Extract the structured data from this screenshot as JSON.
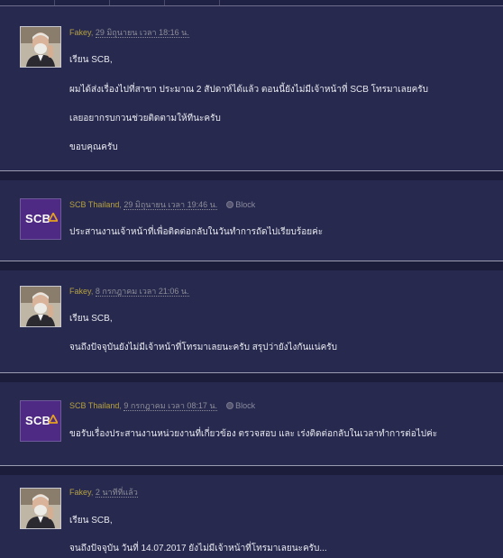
{
  "comments": [
    {
      "author": "Fakey",
      "time": "29 มิถุนายน เวลา 18:16 น.",
      "avatar": "person-avatar",
      "lines": [
        "เรียน SCB,",
        "ผมได้ส่งเรื่องไปที่สาขา ประมาณ 2 สัปดาห์ได้แล้ว ตอนนี้ยังไม่มีเจ้าหน้าที่ SCB โทรมาเลยครับ",
        "เลยอยากรบกวนช่วยติดตามให้ทีนะครับ",
        "ขอบคุณครับ"
      ]
    },
    {
      "author": "SCB Thailand",
      "time": "29 มิถุนายน เวลา 19:46 น.",
      "avatar": "scb-logo",
      "block": "Block",
      "lines": [
        "ประสานงานเจ้าหน้าที่เพื่อติดต่อกลับในวันทำการถัดไปเรียบร้อยค่ะ"
      ]
    },
    {
      "author": "Fakey",
      "time": "8 กรกฎาคม เวลา 21:06 น.",
      "avatar": "person-avatar",
      "lines": [
        "เรียน SCB,",
        "จนถึงปัจจุบันยังไม่มีเจ้าหน้าที่โทรมาเลยนะครับ สรุปว่ายังไงกันแน่ครับ"
      ]
    },
    {
      "author": "SCB Thailand",
      "time": "9 กรกฎาคม เวลา 08:17 น.",
      "avatar": "scb-logo",
      "block": "Block",
      "lines": [
        "ขอรับเรื่องประสานงานหน่วยงานที่เกี่ยวข้อง ตรวจสอบ และ เร่งติดต่อกลับในเวลาทำการต่อไปค่ะ"
      ]
    },
    {
      "author": "Fakey",
      "time": "2 นาทีที่แล้ว",
      "avatar": "person-avatar",
      "lines": [
        "เรียน SCB,",
        "จนถึงปัจจุบัน วันที่ 14.07.2017 ยังไม่มีเจ้าหน้าที่โทรมาเลยนะครับ..."
      ]
    }
  ],
  "scb_logo_text": "SCB",
  "colors": {
    "background": "#272a4e",
    "separator": "#1b1d3a",
    "author": "#b5a040",
    "text": "#e8e8f0",
    "scb_purple": "#4e2a84",
    "scb_gold": "#e6a020"
  }
}
